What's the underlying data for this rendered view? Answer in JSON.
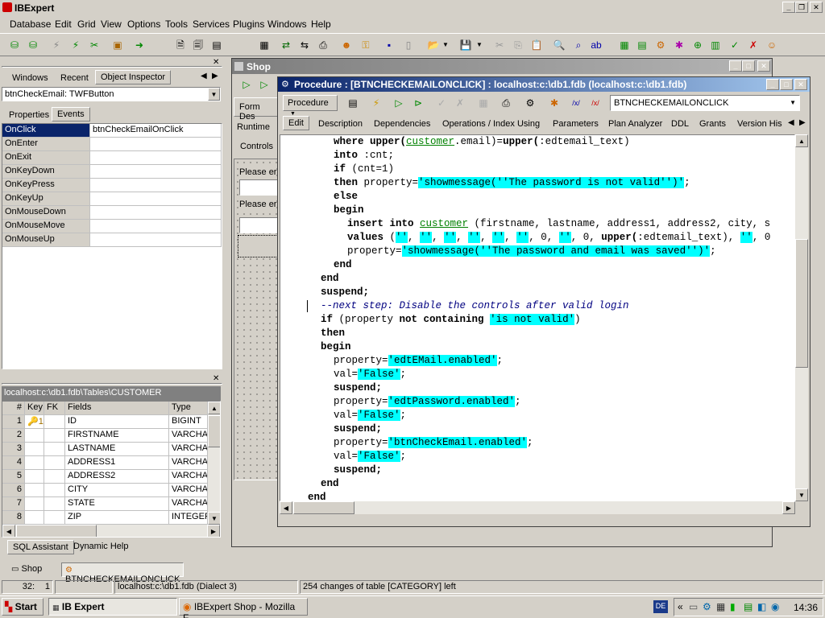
{
  "app": {
    "title": "IBExpert"
  },
  "menu": [
    "Database",
    "Edit",
    "Grid",
    "View",
    "Options",
    "Tools",
    "Services",
    "Plugins",
    "Windows",
    "Help"
  ],
  "left_panel": {
    "tabs": [
      "Windows",
      "Recent",
      "Object Inspector"
    ],
    "object_selector": "btnCheckEmail: TWFButton",
    "inspector_tabs": [
      "Properties",
      "Events"
    ],
    "events": [
      {
        "name": "OnClick",
        "value": "btnCheckEmailOnClick"
      },
      {
        "name": "OnEnter",
        "value": ""
      },
      {
        "name": "OnExit",
        "value": ""
      },
      {
        "name": "OnKeyDown",
        "value": ""
      },
      {
        "name": "OnKeyPress",
        "value": ""
      },
      {
        "name": "OnKeyUp",
        "value": ""
      },
      {
        "name": "OnMouseDown",
        "value": ""
      },
      {
        "name": "OnMouseMove",
        "value": ""
      },
      {
        "name": "OnMouseUp",
        "value": ""
      }
    ],
    "table_path": "localhost:c:\\db1.fdb\\Tables\\CUSTOMER",
    "table_headers": [
      "#",
      "Key",
      "FK",
      "Fields",
      "Type"
    ],
    "table_rows": [
      {
        "n": "1",
        "key": "🔑1",
        "fk": "",
        "field": "ID",
        "type": "BIGINT"
      },
      {
        "n": "2",
        "key": "",
        "fk": "",
        "field": "FIRSTNAME",
        "type": "VARCHAR"
      },
      {
        "n": "3",
        "key": "",
        "fk": "",
        "field": "LASTNAME",
        "type": "VARCHAR"
      },
      {
        "n": "4",
        "key": "",
        "fk": "",
        "field": "ADDRESS1",
        "type": "VARCHAR"
      },
      {
        "n": "5",
        "key": "",
        "fk": "",
        "field": "ADDRESS2",
        "type": "VARCHAR"
      },
      {
        "n": "6",
        "key": "",
        "fk": "",
        "field": "CITY",
        "type": "VARCHAR"
      },
      {
        "n": "7",
        "key": "",
        "fk": "",
        "field": "STATE",
        "type": "VARCHAR"
      },
      {
        "n": "8",
        "key": "",
        "fk": "",
        "field": "ZIP",
        "type": "INTEGER"
      }
    ],
    "bottom_tabs": [
      "SQL Assistant",
      "Dynamic Help"
    ]
  },
  "shop": {
    "title": "Shop",
    "side_items": [
      "Form Des",
      "Runtime",
      "Controls"
    ],
    "form_labels": [
      "Please er",
      "Please er"
    ]
  },
  "procedure": {
    "title": "Procedure : [BTNCHECKEMAILONCLICK] : localhost:c:\\db1.fdb (localhost:c:\\db1.fdb)",
    "dropdown_label": "Procedure",
    "name_value": "BTNCHECKEMAILONCLICK",
    "tabs": [
      "Edit",
      "Description",
      "Dependencies",
      "Operations / Index Using",
      "Parameters",
      "Plan Analyzer",
      "DDL",
      "Grants",
      "Version His"
    ]
  },
  "code": {
    "l1a": "where ",
    "l1b": "upper(",
    "l1c": "customer",
    "l1d": ".email)=",
    "l1e": "upper(",
    "l1f": ":edtemail_text)",
    "l2a": "into",
    "l2b": " :cnt;",
    "l3a": "if",
    "l3b": " (cnt=1)",
    "l4a": "then",
    "l4b": " property=",
    "l4c": "'showmessage(''The password is not valid'')'",
    "l4d": ";",
    "l5": "else",
    "l6": "begin",
    "l7a": "insert into",
    "l7b": " ",
    "l7c": "customer",
    "l7d": " (firstname, lastname, address1, address2, city, s",
    "l8a": "values",
    "l8b": " (",
    "l8c": "''",
    "l8d": ", ",
    "l8e": "''",
    "l8f": ", ",
    "l8g": "''",
    "l8h": ", ",
    "l8i": "''",
    "l8j": ", ",
    "l8k": "''",
    "l8l": ", ",
    "l8m": "''",
    "l8n": ", 0, ",
    "l8o": "''",
    "l8p": ", 0, ",
    "l8q": "upper(",
    "l8r": ":edtemail_text), ",
    "l8s": "''",
    "l8t": ", 0",
    "l9a": "property=",
    "l9b": "'showmessage(''The password and email was saved'')'",
    "l9c": ";",
    "l10": "end",
    "l11": "end",
    "l12": "suspend;",
    "l13": "--next step: Disable the controls after valid login",
    "l14a": "if",
    "l14b": " (property ",
    "l14c": "not containing",
    "l14d": " ",
    "l14e": "'is not valid'",
    "l14f": ")",
    "l15": "then",
    "l16": "begin",
    "l17a": "property=",
    "l17b": "'edtEMail.enabled'",
    "l17c": ";",
    "l18a": "val=",
    "l18b": "'False'",
    "l18c": ";",
    "l19": "suspend;",
    "l20a": "property=",
    "l20b": "'edtPassword.enabled'",
    "l20c": ";",
    "l21a": "val=",
    "l21b": "'False'",
    "l21c": ";",
    "l22": "suspend;",
    "l23a": "property=",
    "l23b": "'btnCheckEmail.enabled'",
    "l23c": ";",
    "l24a": "val=",
    "l24b": "'False'",
    "l24c": ";",
    "l25": "suspend;",
    "l26": "end",
    "l27": "end"
  },
  "mdi_tabs": [
    "Shop",
    "BTNCHECKEMAILONCLICK"
  ],
  "status": {
    "position": "32:",
    "col": "1",
    "db": "localhost:c:\\db1.fdb (Dialect 3)",
    "msg": "254 changes of table [CATEGORY] left"
  },
  "taskbar": {
    "start": "Start",
    "items": [
      "IB Expert",
      "IBExpert Shop - Mozilla F..."
    ],
    "clock": "14:36"
  }
}
